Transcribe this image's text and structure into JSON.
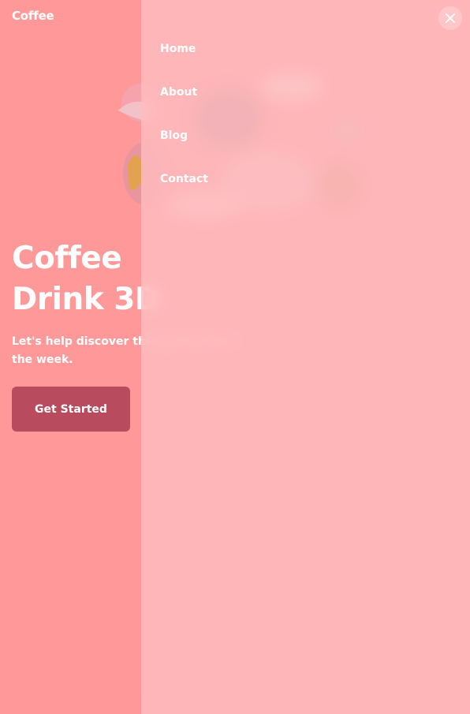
{
  "brand": {
    "name": "Coffee"
  },
  "hero": {
    "title_line1": "Coffee",
    "title_line2": "Drink 3D",
    "subtitle": "Let's help discover the best drink of the week.",
    "cta_label": "Get Started"
  },
  "menu": {
    "items": [
      {
        "label": "Home"
      },
      {
        "label": "About"
      },
      {
        "label": "Blog"
      },
      {
        "label": "Contact"
      }
    ],
    "close_icon": "close-icon"
  },
  "colors": {
    "background": "#ff9999",
    "overlay": "#ffbec0",
    "button": "#b84c5e",
    "text": "#ffffff"
  }
}
